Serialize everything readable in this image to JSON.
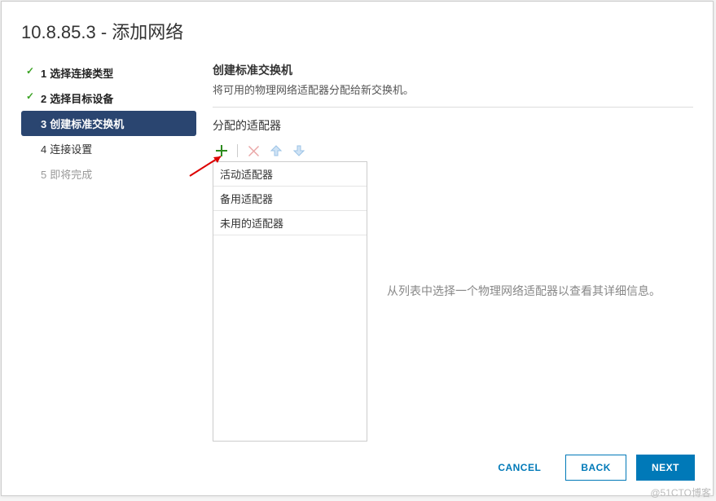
{
  "dialog": {
    "title": "10.8.85.3 - 添加网络"
  },
  "wizard": {
    "steps": [
      {
        "num": "1",
        "label": "选择连接类型"
      },
      {
        "num": "2",
        "label": "选择目标设备"
      },
      {
        "num": "3",
        "label": "创建标准交换机"
      },
      {
        "num": "4",
        "label": "连接设置"
      },
      {
        "num": "5",
        "label": "即将完成"
      }
    ]
  },
  "content": {
    "title": "创建标准交换机",
    "desc": "将可用的物理网络适配器分配给新交换机。",
    "section_label": "分配的适配器",
    "placeholder": "从列表中选择一个物理网络适配器以查看其详细信息。"
  },
  "adapters": {
    "groups": [
      "活动适配器",
      "备用适配器",
      "未用的适配器"
    ]
  },
  "footer": {
    "cancel": "CANCEL",
    "back": "BACK",
    "next": "NEXT"
  },
  "watermark": "@51CTO博客"
}
